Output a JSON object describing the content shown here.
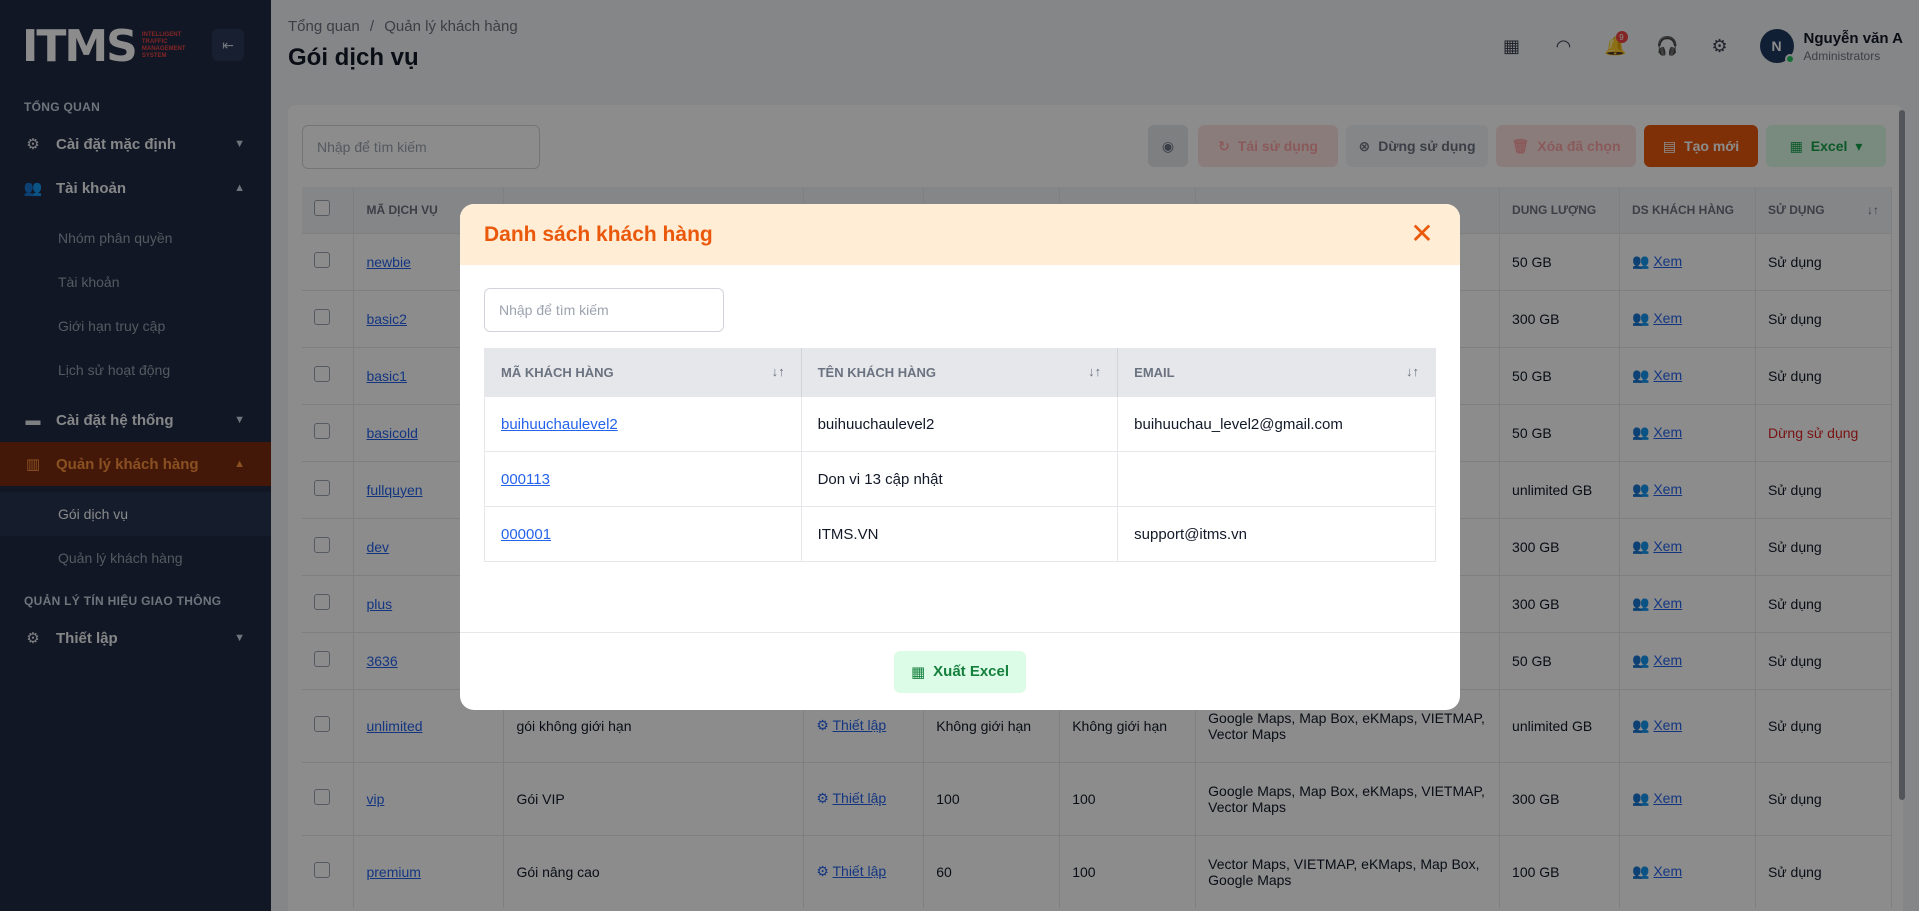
{
  "app": {
    "logo_text": "ITMS",
    "logo_tagline": [
      "INTELLIGENT",
      "TRAFFIC",
      "MANAGEMENT",
      "SYSTEM"
    ]
  },
  "sidebar": {
    "section_overview": "TỔNG QUAN",
    "items": [
      {
        "label": "Cài đặt mặc định",
        "icon": "gear-icon"
      },
      {
        "label": "Tài khoản",
        "icon": "users-icon"
      }
    ],
    "account_sub": [
      "Nhóm phân quyền",
      "Tài khoản",
      "Giới hạn truy cập",
      "Lịch sử hoạt động"
    ],
    "system": {
      "label": "Cài đặt hệ thống",
      "icon": "card-icon"
    },
    "customers": {
      "label": "Quản lý khách hàng",
      "icon": "building-icon"
    },
    "customers_sub": [
      "Gói dịch vụ",
      "Quản lý khách hàng"
    ],
    "section_traffic": "QUẢN LÝ TÍN HIỆU GIAO THÔNG",
    "setup": {
      "label": "Thiết lập",
      "icon": "gear-icon"
    }
  },
  "header": {
    "breadcrumb_home": "Tổng quan",
    "breadcrumb_sep": "/",
    "breadcrumb_current": "Quản lý khách hàng",
    "title": "Gói dịch vụ",
    "notification_count": "9",
    "user_name": "Nguyễn văn A",
    "user_role": "Administrators",
    "avatar_initial": "N"
  },
  "toolbar": {
    "search_placeholder": "Nhập để tìm kiếm",
    "reuse_label": "Tái sử dụng",
    "stop_label": "Dừng sử dụng",
    "delete_label": "Xóa đã chọn",
    "new_label": "Tạo mới",
    "excel_label": "Excel"
  },
  "grid": {
    "headers": {
      "code": "MÃ DỊCH VỤ",
      "capacity": "DUNG LƯỢNG",
      "customers": "DS KHÁCH HÀNG",
      "usage": "SỬ DỤNG"
    },
    "view_label": "Xem",
    "setup_label": "Thiết lập",
    "rows": [
      {
        "code": "newbie",
        "capacity": "50 GB",
        "usage": "Sử dụng"
      },
      {
        "code": "basic2",
        "capacity": "300 GB",
        "usage": "Sử dụng"
      },
      {
        "code": "basic1",
        "capacity": "50 GB",
        "usage": "Sử dụng"
      },
      {
        "code": "basicold",
        "capacity": "50 GB",
        "usage": "Dừng sử dụng"
      },
      {
        "code": "fullquyen",
        "capacity": "unlimited GB",
        "usage": "Sử dụng"
      },
      {
        "code": "dev",
        "capacity": "300 GB",
        "usage": "Sử dụng"
      },
      {
        "code": "plus",
        "capacity": "300 GB",
        "usage": "Sử dụng"
      },
      {
        "code": "3636",
        "capacity": "50 GB",
        "usage": "Sử dụng"
      },
      {
        "code": "unlimited",
        "name": "gói không giới hạn",
        "a": "Không giới hạn",
        "b": "Không giới hạn",
        "maps": "Google Maps, Map Box, eKMaps, VIETMAP, Vector Maps",
        "capacity": "unlimited GB",
        "usage": "Sử dụng"
      },
      {
        "code": "vip",
        "name": "Gói VIP",
        "a": "100",
        "b": "100",
        "maps": "Google Maps, Map Box, eKMaps, VIETMAP, Vector Maps",
        "capacity": "300 GB",
        "usage": "Sử dụng"
      },
      {
        "code": "premium",
        "name": "Gói nâng cao",
        "a": "60",
        "b": "100",
        "maps": "Vector Maps, VIETMAP, eKMaps, Map Box, Google Maps",
        "capacity": "100 GB",
        "usage": "Sử dụng"
      }
    ]
  },
  "modal": {
    "title": "Danh sách khách hàng",
    "search_placeholder": "Nhập để tìm kiếm",
    "headers": {
      "code": "MÃ KHÁCH HÀNG",
      "name": "TÊN KHÁCH HÀNG",
      "email": "EMAIL"
    },
    "rows": [
      {
        "code": "buihuuchaulevel2",
        "name": "buihuuchaulevel2",
        "email": "buihuuchau_level2@gmail.com"
      },
      {
        "code": "000113",
        "name": "Don vi 13 cập nhật",
        "email": ""
      },
      {
        "code": "000001",
        "name": "ITMS.VN",
        "email": "support@itms.vn"
      }
    ],
    "export_label": "Xuất Excel"
  },
  "colors": {
    "sidebar": "#1f2a44",
    "accent": "#ea580c",
    "link": "#2563eb",
    "modal_header": "#ffedd5"
  }
}
